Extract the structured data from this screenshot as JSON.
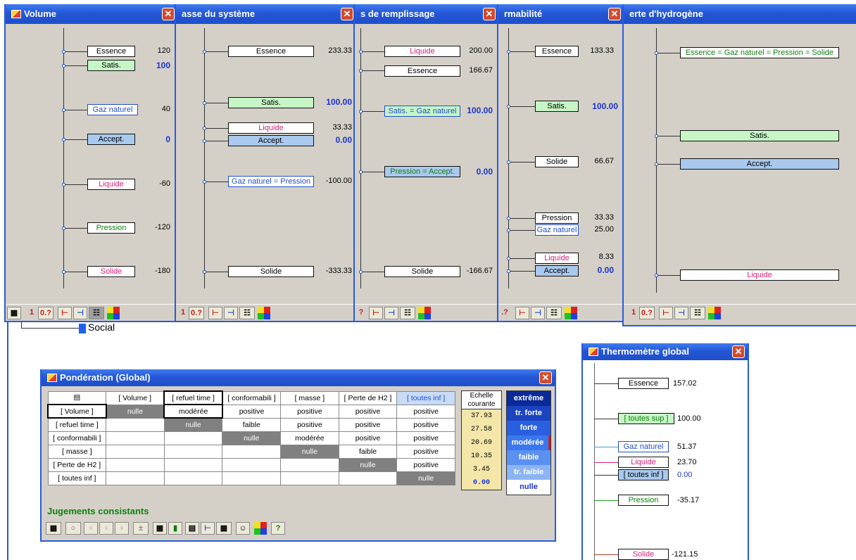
{
  "windows": {
    "volume": {
      "title": "Volume",
      "items": [
        {
          "label": "Essence",
          "value": "120"
        },
        {
          "label": "Satis.",
          "value": "100"
        },
        {
          "label": "Gaz naturel",
          "value": "40"
        },
        {
          "label": "Accept.",
          "value": "0"
        },
        {
          "label": "Liquide",
          "value": "-60"
        },
        {
          "label": "Pression",
          "value": "-120"
        },
        {
          "label": "Solide",
          "value": "-180"
        }
      ]
    },
    "masse": {
      "title": "asse du système",
      "items": [
        {
          "label": "Essence",
          "value": "233.33"
        },
        {
          "label": "Satis.",
          "value": "100.00"
        },
        {
          "label": "Liquide",
          "value": "33.33"
        },
        {
          "label": "Accept.",
          "value": "0.00"
        },
        {
          "label": "Gaz naturel = Pression",
          "value": "-100.00"
        },
        {
          "label": "Solide",
          "value": "-333.33"
        }
      ]
    },
    "refuel": {
      "title": "s de remplissage",
      "items": [
        {
          "label": "Liquide",
          "value": "200.00"
        },
        {
          "label": "Essence",
          "value": "166.67"
        },
        {
          "label": "Satis. = Gaz naturel",
          "value": "100.00"
        },
        {
          "label": "Pression = Accept.",
          "value": "0.00"
        },
        {
          "label": "Solide",
          "value": "-166.67"
        }
      ]
    },
    "conform": {
      "title": "rmabilité",
      "items": [
        {
          "label": "Essence",
          "value": "133.33"
        },
        {
          "label": "Satis.",
          "value": "100.00"
        },
        {
          "label": "Solide",
          "value": "66.67"
        },
        {
          "label": "Pression",
          "value": "33.33"
        },
        {
          "label": "Gaz naturel",
          "value": "25.00"
        },
        {
          "label": "Liquide",
          "value": "8.33"
        },
        {
          "label": "Accept.",
          "value": "0.00"
        }
      ]
    },
    "h2": {
      "title": "erte d'hydrogène",
      "items": [
        {
          "label": "Essence = Gaz naturel = Pression = Solide"
        },
        {
          "label": "Satis."
        },
        {
          "label": "Accept."
        },
        {
          "label": "Liquide"
        }
      ]
    }
  },
  "toolbar": {
    "one": "1",
    "zero": "0.?",
    "partial": "?",
    "partial2": ".?"
  },
  "social_label": "Social",
  "ponderation": {
    "title": "Pondération (Global)",
    "headers": [
      "[ Volume ]",
      "[ refuel time ]",
      "[ conformabili ]",
      "[ masse ]",
      "[ Perte de H2 ]",
      "[ toutes inf ]"
    ],
    "rows": [
      {
        "name": "[ Volume ]",
        "cells": [
          "nulle",
          "modérée",
          "positive",
          "positive",
          "positive",
          "positive"
        ]
      },
      {
        "name": "[ refuel time ]",
        "cells": [
          "",
          "nulle",
          "faible",
          "positive",
          "positive",
          "positive"
        ]
      },
      {
        "name": "[ conformabili ]",
        "cells": [
          "",
          "",
          "nulle",
          "modérée",
          "positive",
          "positive"
        ]
      },
      {
        "name": "[ masse ]",
        "cells": [
          "",
          "",
          "",
          "nulle",
          "faible",
          "positive"
        ]
      },
      {
        "name": "[ Perte de H2 ]",
        "cells": [
          "",
          "",
          "",
          "",
          "nulle",
          "positive"
        ]
      },
      {
        "name": "[ toutes inf ]",
        "cells": [
          "",
          "",
          "",
          "",
          "",
          "nulle"
        ]
      }
    ],
    "scale_header": "Echelle courante",
    "scale": [
      "37.93",
      "27.58",
      "20.69",
      "10.35",
      "3.45",
      "0.00"
    ],
    "legend": [
      "extrême",
      "tr. forte",
      "forte",
      "modérée",
      "faible",
      "tr. faible",
      "nulle"
    ],
    "status": "Jugements consistants"
  },
  "thermo": {
    "title": "Thermomètre global",
    "items": [
      {
        "label": "Essence",
        "value": "157.02"
      },
      {
        "label": "[ toutes sup ]",
        "value": "100.00"
      },
      {
        "label": "Gaz naturel",
        "value": "51.37"
      },
      {
        "label": "Liquide",
        "value": "23.70"
      },
      {
        "label": "[ toutes inf ]",
        "value": "0.00"
      },
      {
        "label": "Pression",
        "value": "-35.17"
      },
      {
        "label": "Solide",
        "value": "-121.15"
      }
    ]
  },
  "colors": {
    "title_bar": "#2457d6",
    "satis_fill": "#c6f5c6",
    "accept_fill": "#a9c9ee",
    "liquid_text": "#d8207a",
    "gas_text": "#2050c8"
  }
}
